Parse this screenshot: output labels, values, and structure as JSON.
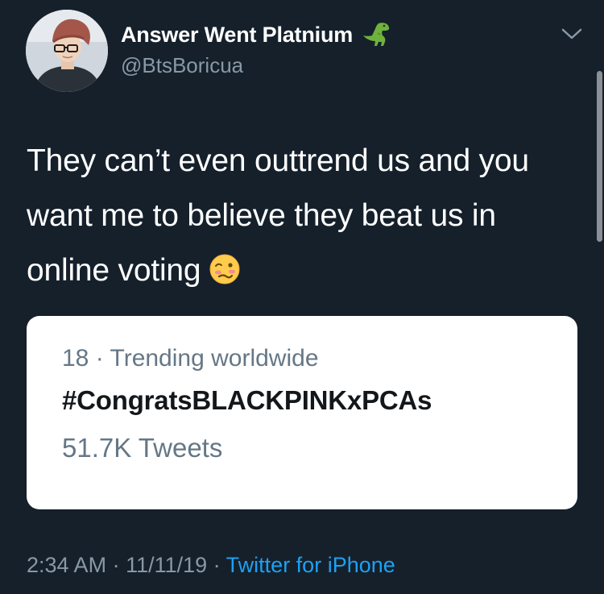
{
  "tweet": {
    "author": {
      "display_name": "Answer Went Platnium",
      "name_emoji": "t-rex-emoji",
      "handle": "@BtsBoricua"
    },
    "text": "They can’t even outtrend us and you want me to believe they beat us in online voting",
    "text_emoji": "woozy-face-emoji",
    "trend_card": {
      "meta": "18 · Trending worldwide",
      "hashtag": "#CongratsBLACKPINKxPCAs",
      "count": "51.7K Tweets"
    },
    "footer": {
      "time": "2:34 AM",
      "sep1": " · ",
      "date": "11/11/19",
      "sep2": " · ",
      "source": "Twitter for iPhone"
    }
  },
  "colors": {
    "background": "#15202b",
    "secondary_text": "#8899a6",
    "link": "#1da1f2",
    "card_background": "#ffffff"
  },
  "icons": {
    "menu": "chevron-down-icon",
    "avatar": "profile-photo"
  }
}
